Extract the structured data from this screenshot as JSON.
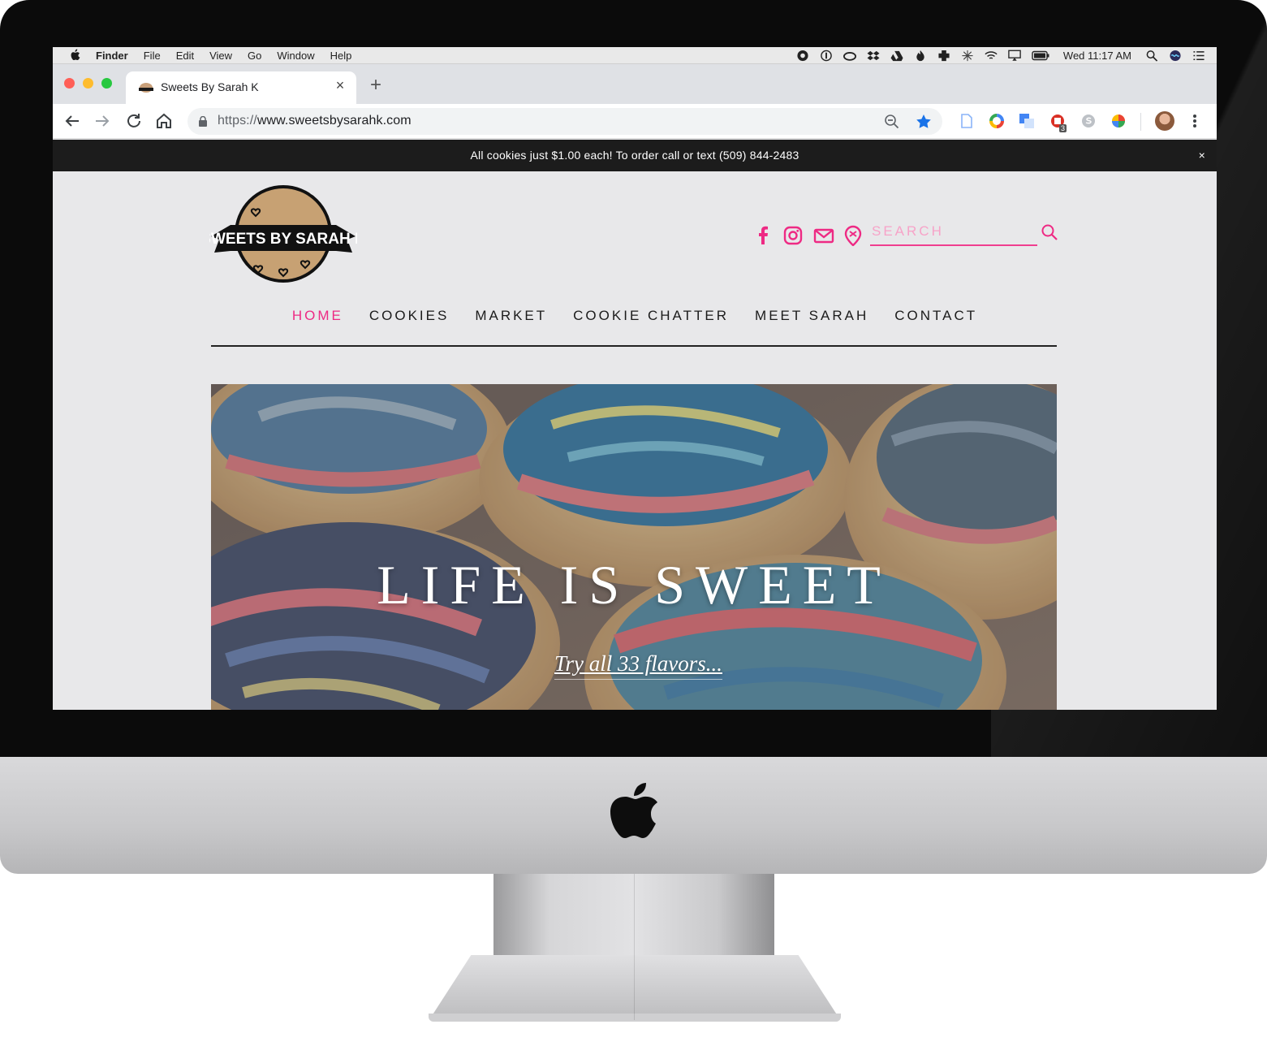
{
  "menubar": {
    "app": "Finder",
    "menus": [
      "File",
      "Edit",
      "View",
      "Go",
      "Window",
      "Help"
    ],
    "clock": "Wed 11:17 AM"
  },
  "browser": {
    "tab_title": "Sweets By Sarah K",
    "new_tab": "+",
    "tab_close": "×",
    "url_scheme": "https://",
    "url_host": "www.sweetsbysarahk.com",
    "extension_badge": "3"
  },
  "site": {
    "announcement": "All cookies just $1.00 each! To order call or text (509) 844-2483",
    "announcement_close": "×",
    "logo_text": [
      "SWEETS",
      "BY",
      "SARAH K"
    ],
    "search_placeholder": "SEARCH",
    "nav": [
      "HOME",
      "COOKIES",
      "MARKET",
      "COOKIE CHATTER",
      "MEET SARAH",
      "CONTACT"
    ],
    "active_nav": "HOME",
    "hero_title": "LIFE IS SWEET",
    "hero_link": "Try all 33 flavors..."
  },
  "colors": {
    "accent_pink": "#ee2a84",
    "announce_bg": "#1c1c1c",
    "page_bg": "#e8e8ea"
  },
  "icons": [
    "apple-icon",
    "facebook-icon",
    "instagram-icon",
    "mail-icon",
    "location-icon",
    "search-icon",
    "star-icon",
    "zoom-icon",
    "lock-icon"
  ]
}
